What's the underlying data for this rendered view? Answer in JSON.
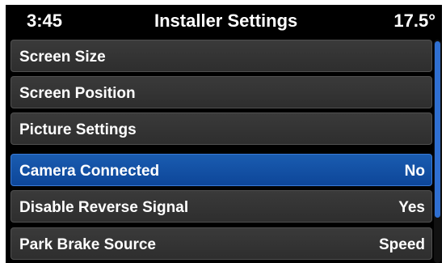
{
  "header": {
    "time": "3:45",
    "title": "Installer Settings",
    "temperature": "17.5°"
  },
  "menu": {
    "items": [
      {
        "label": "Screen Size",
        "value": ""
      },
      {
        "label": "Screen Position",
        "value": ""
      },
      {
        "label": "Picture Settings",
        "value": ""
      },
      {
        "label": "Camera Connected",
        "value": "No"
      },
      {
        "label": "Disable Reverse Signal",
        "value": "Yes"
      },
      {
        "label": "Park Brake Source",
        "value": "Speed"
      }
    ],
    "selected_index": 3
  },
  "scrollbar": {
    "visible_fraction": 0.8,
    "position_fraction": 0.0
  },
  "colors": {
    "background": "#000000",
    "item": "#333333",
    "selected": "#1152a8",
    "scroll_thumb": "#2f6fd1",
    "text": "#ffffff"
  }
}
